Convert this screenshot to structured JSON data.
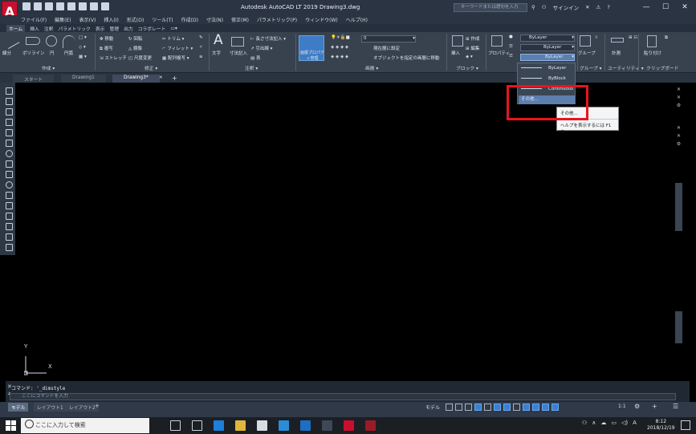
{
  "window": {
    "title": "Autodesk AutoCAD LT 2019    Drawing3.dwg",
    "search_placeholder": "キーワードまたは語句を入力",
    "signin": "サインイン",
    "logo_text": "A",
    "logo_sub": "LT",
    "minimize": "—",
    "maximize": "☐",
    "close": "✕"
  },
  "menus": [
    "ファイル(F)",
    "編集(E)",
    "表示(V)",
    "挿入(I)",
    "形式(O)",
    "ツール(T)",
    "作成(D)",
    "寸法(N)",
    "修正(M)",
    "パラメトリック(P)",
    "ウィンドウ(W)",
    "ヘルプ(H)"
  ],
  "ribbon_tabs": [
    "ホーム",
    "挿入",
    "注釈",
    "パラメトリック",
    "表示",
    "管理",
    "出力",
    "コラボレート"
  ],
  "ribbon": {
    "panels": [
      {
        "title": "作成 ▾"
      },
      {
        "title": "修正 ▾"
      },
      {
        "title": "注釈 ▾"
      },
      {
        "title": "画層 ▾"
      },
      {
        "title": "ブロック ▾"
      },
      {
        "title": "プロパティ"
      },
      {
        "title": "グループ ▾"
      },
      {
        "title": "ユーティリティ ▾"
      },
      {
        "title": "クリップボード"
      }
    ],
    "draw_tools": [
      "線分",
      "ポリライン",
      "円",
      "円弧"
    ],
    "modify_tools": [
      "移動",
      "回転",
      "トリム",
      "複写",
      "鏡像",
      "フィレット",
      "ストレッチ",
      "尺度変更",
      "配列複写"
    ],
    "annotate_tools": [
      "文字",
      "寸法記入",
      "長さ寸法記入",
      "引出線",
      "表"
    ],
    "layer_label": "画層プロパティ管理",
    "layer_tools": [
      "現在層に設定",
      "オブジェクトを指定の画層に移動"
    ],
    "layer_current": "0",
    "block_tools": [
      "挿入",
      "作成",
      "編集"
    ],
    "properties": {
      "color": "ByLayer",
      "linetype": "ByLayer",
      "lineweight": "ByLayer"
    },
    "group_label": "グループ",
    "measure_label": "計測",
    "paste_label": "貼り付け"
  },
  "doc_tabs": [
    {
      "label": "スタート",
      "active": false
    },
    {
      "label": "Drawing1",
      "active": false
    },
    {
      "label": "Drawing3*",
      "active": true
    }
  ],
  "linetype_dropdown": {
    "items": [
      "ByLayer",
      "ByBlock",
      "Continuous",
      "その他..."
    ],
    "highlighted": "その他..."
  },
  "context_popup": {
    "title": "その他...",
    "hint": "ヘルプを表示するには F1 キー"
  },
  "command": {
    "history": "コマンド: '_dimstyle",
    "placeholder": "ここにコマンドを入力"
  },
  "layout_tabs": [
    "モデル",
    "レイアウト1",
    "レイアウト2"
  ],
  "status": {
    "model_label": "モデル",
    "scale": "1:1"
  },
  "taskbar": {
    "search_placeholder": "ここに入力して検索",
    "time": "8:12",
    "date": "2018/12/19",
    "ime": "A"
  },
  "ucs": {
    "x": "X",
    "y": "Y"
  },
  "colors": {
    "accent_red": "#e8141f",
    "autocad_red": "#c8102e",
    "highlight_blue": "#5d7fb0"
  }
}
